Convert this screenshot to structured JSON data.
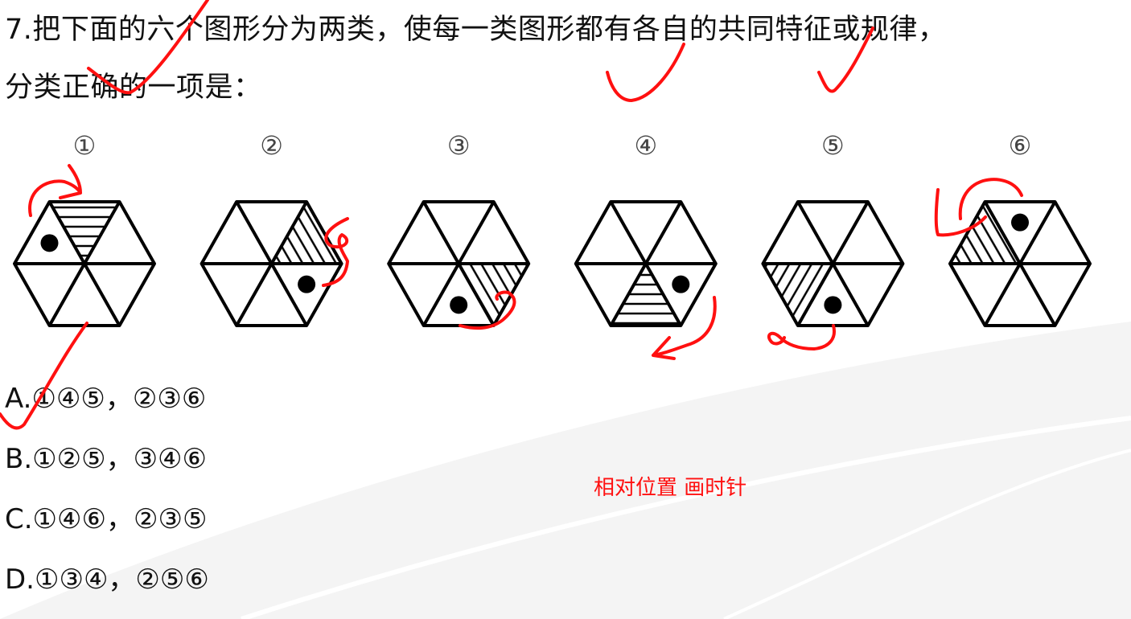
{
  "question": {
    "line1": "7.把下面的六个图形分为两类，使每一类图形都有各自的共同特征或规律，",
    "line2": "分类正确的一项是："
  },
  "figures": [
    {
      "label": "①",
      "shaded": "top",
      "hatch": "horizontal",
      "dot": "upper-left"
    },
    {
      "label": "②",
      "shaded": "upper-right",
      "hatch": "diagonal",
      "dot": "lower-right"
    },
    {
      "label": "③",
      "shaded": "lower-right",
      "hatch": "diagonal",
      "dot": "bottom"
    },
    {
      "label": "④",
      "shaded": "bottom",
      "hatch": "horizontal",
      "dot": "lower-right"
    },
    {
      "label": "⑤",
      "shaded": "lower-left",
      "hatch": "diagonal-back",
      "dot": "bottom"
    },
    {
      "label": "⑥",
      "shaded": "upper-left",
      "hatch": "diagonal",
      "dot": "top"
    }
  ],
  "options": [
    {
      "text": "A.①④⑤，②③⑥"
    },
    {
      "text": "B.①②⑤，③④⑥"
    },
    {
      "text": "C.①④⑥，②③⑤"
    },
    {
      "text": "D.①③④，②⑤⑥"
    }
  ],
  "annotation": {
    "note": "相对位置 画时针",
    "color": "#ff1010"
  }
}
